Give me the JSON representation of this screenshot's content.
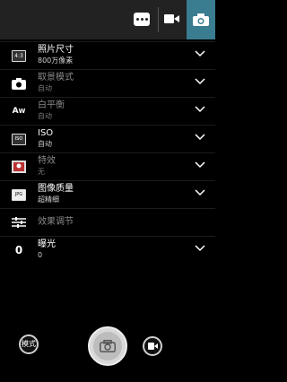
{
  "topbar": {
    "more_icon": "more-dots-icon",
    "video_icon": "video-camera-icon",
    "photo_icon": "camera-icon",
    "active_tab_color": "#3a7c90"
  },
  "settings": [
    {
      "label": "照片尺寸",
      "value": "800万像素",
      "icon_text": "4:3",
      "dim": false
    },
    {
      "label": "取景模式",
      "value": "自动",
      "icon_text": "",
      "dim": true
    },
    {
      "label": "白平衡",
      "value": "自动",
      "icon_text": "A",
      "dim": true
    },
    {
      "label": "ISO",
      "value": "自动",
      "icon_text": "ISO",
      "dim": false
    },
    {
      "label": "特效",
      "value": "无",
      "icon_text": "",
      "dim": true
    },
    {
      "label": "图像质量",
      "value": "超精细",
      "icon_text": "JPG",
      "dim": false
    },
    {
      "label": "效果调节",
      "value": "",
      "icon_text": "",
      "dim": true
    },
    {
      "label": "曝光",
      "value": "0",
      "icon_text": "0",
      "dim": false
    }
  ],
  "bottom": {
    "mode_label": "模式",
    "shutter_icon": "camera-shutter-icon",
    "video_icon": "video-record-icon"
  }
}
